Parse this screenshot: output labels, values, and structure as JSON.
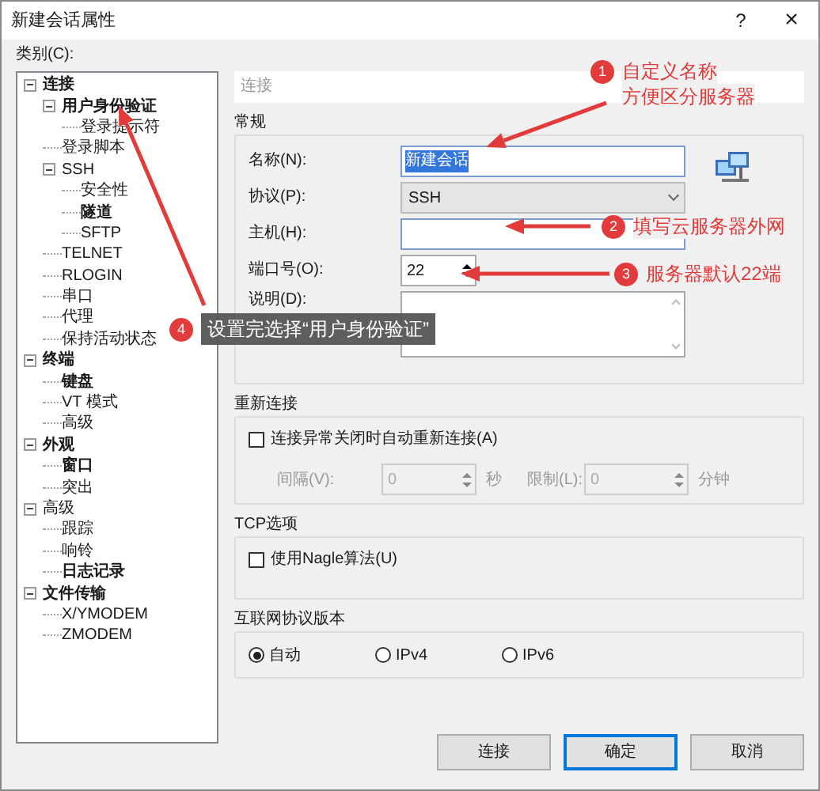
{
  "window": {
    "title": "新建会话属性",
    "help": "?",
    "close": "×"
  },
  "category_label": "类别(C):",
  "tree": [
    {
      "label": "连接",
      "bold": true,
      "expanded": true,
      "children": [
        {
          "label": "用户身份验证",
          "bold": true,
          "expanded": true,
          "children": [
            {
              "label": "登录提示符",
              "bold": false
            }
          ]
        },
        {
          "label": "登录脚本",
          "bold": false
        },
        {
          "label": "SSH",
          "bold": false,
          "expanded": true,
          "children": [
            {
              "label": "安全性",
              "bold": false
            },
            {
              "label": "隧道",
              "bold": true
            },
            {
              "label": "SFTP",
              "bold": false
            }
          ]
        },
        {
          "label": "TELNET",
          "bold": false
        },
        {
          "label": "RLOGIN",
          "bold": false
        },
        {
          "label": "串口",
          "bold": false
        },
        {
          "label": "代理",
          "bold": false
        },
        {
          "label": "保持活动状态",
          "bold": false
        }
      ]
    },
    {
      "label": "终端",
      "bold": true,
      "expanded": true,
      "children": [
        {
          "label": "键盘",
          "bold": true
        },
        {
          "label": "VT 模式",
          "bold": false
        },
        {
          "label": "高级",
          "bold": false
        }
      ]
    },
    {
      "label": "外观",
      "bold": true,
      "expanded": true,
      "children": [
        {
          "label": "窗口",
          "bold": true
        },
        {
          "label": "突出",
          "bold": false
        }
      ]
    },
    {
      "label": "高级",
      "bold": false,
      "expanded": true,
      "children": [
        {
          "label": "跟踪",
          "bold": false
        },
        {
          "label": "响铃",
          "bold": false
        },
        {
          "label": "日志记录",
          "bold": true
        }
      ]
    },
    {
      "label": "文件传输",
      "bold": true,
      "expanded": true,
      "children": [
        {
          "label": "X/YMODEM",
          "bold": false
        },
        {
          "label": "ZMODEM",
          "bold": false
        }
      ]
    }
  ],
  "header": "连接",
  "general": {
    "title": "常规",
    "fields": [
      {
        "kind": "text",
        "label": "名称(N):",
        "value": "新建会话",
        "text_selected": true
      },
      {
        "kind": "select",
        "label": "协议(P):",
        "value": "SSH"
      },
      {
        "kind": "text",
        "label": "主机(H):"
      },
      {
        "kind": "spin",
        "label": "端口号(O):",
        "value": "22"
      },
      {
        "kind": "textarea",
        "label": "说明(D):"
      }
    ]
  },
  "reconnect": {
    "title": "重新连接",
    "checkbox": {
      "label": "连接异常关闭时自动重新连接(A)",
      "checked": false
    },
    "interval": {
      "label": "间隔(V):",
      "value": "0",
      "unit": "秒",
      "disabled": true
    },
    "limit": {
      "label": "限制(L):",
      "value": "0",
      "unit": "分钟",
      "disabled": true
    }
  },
  "tcp": {
    "title": "TCP选项",
    "checkbox": {
      "label": "使用Nagle算法(U)",
      "checked": false
    }
  },
  "ip_version": {
    "title": "互联网协议版本",
    "options": [
      {
        "label": "自动",
        "selected": true
      },
      {
        "label": "IPv4",
        "selected": false
      },
      {
        "label": "IPv6",
        "selected": false
      }
    ]
  },
  "buttons": [
    {
      "label": "连接",
      "default": false
    },
    {
      "label": "确定",
      "default": true
    },
    {
      "label": "取消",
      "default": false
    }
  ],
  "annotations": [
    {
      "kind": "note",
      "number": "1",
      "lines": [
        "自定义名称",
        "方便区分服务器"
      ]
    },
    {
      "kind": "note",
      "number": "2",
      "lines": [
        "填写云服务器外网"
      ]
    },
    {
      "kind": "note",
      "number": "3",
      "lines": [
        "服务器默认22端"
      ]
    },
    {
      "kind": "callout",
      "number": "4",
      "lines": [
        "设置完选择“用户身份验证”"
      ]
    }
  ]
}
